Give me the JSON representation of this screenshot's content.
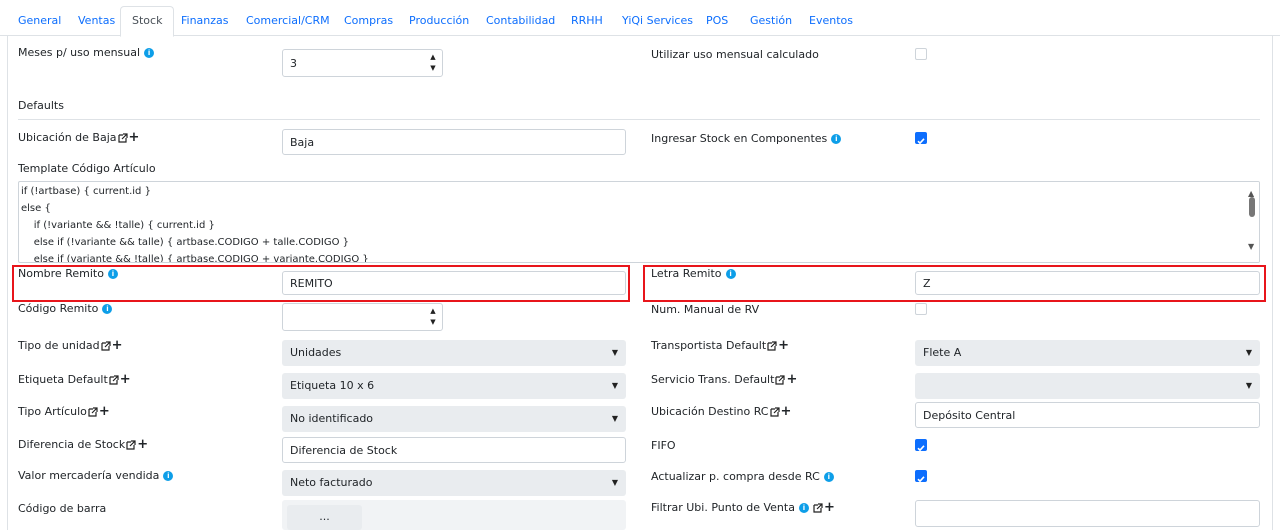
{
  "tabs": [
    "General",
    "Ventas",
    "Stock",
    "Finanzas",
    "Comercial/CRM",
    "Compras",
    "Producción",
    "Contabilidad",
    "RRHH",
    "YiQi Services",
    "POS",
    "Gestión",
    "Eventos"
  ],
  "fields": {
    "meses_label": "Meses p/ uso mensual",
    "meses_value": "3",
    "utilizar_label": "Utilizar uso mensual calculado",
    "defaults_label": "Defaults",
    "ubicacion_baja_label": "Ubicación de Baja",
    "ubicacion_baja_value": "Baja",
    "ingresar_stock_label": "Ingresar Stock en Componentes",
    "template_label": "Template Código Artículo",
    "template_lines": [
      "if (!artbase) { current.id }",
      "else {",
      "    if (!variante && !talle) { current.id }",
      "    else if (!variante && talle) { artbase.CODIGO + talle.CODIGO }",
      "    else if (variante && !talle) { artbase.CODIGO + variante.CODIGO }"
    ],
    "nombre_remito_label": "Nombre Remito",
    "nombre_remito_value": "REMITO",
    "letra_remito_label": "Letra Remito",
    "letra_remito_value": "Z",
    "codigo_remito_label": "Código Remito",
    "num_manual_label": "Num. Manual de RV",
    "tipo_unidad_label": "Tipo de unidad",
    "tipo_unidad_value": "Unidades",
    "transportista_label": "Transportista Default",
    "transportista_value": "Flete A",
    "etiqueta_label": "Etiqueta Default",
    "etiqueta_value": "Etiqueta 10 x 6",
    "servicio_label": "Servicio Trans. Default",
    "servicio_value": "",
    "tipo_articulo_label": "Tipo Artículo",
    "tipo_articulo_value": "No identificado",
    "ubicacion_destino_label": "Ubicación Destino RC",
    "ubicacion_destino_value": "Depósito Central",
    "diferencia_label": "Diferencia de Stock",
    "diferencia_value": "Diferencia de Stock",
    "fifo_label": "FIFO",
    "valor_label": "Valor mercadería vendida",
    "valor_value": "Neto facturado",
    "actualizar_label": "Actualizar p. compra desde RC",
    "codigo_barra_label": "Código de barra",
    "codigo_barra_btn": "...",
    "filtrar_label": "Filtrar Ubi. Punto de Venta"
  },
  "colors": {
    "accent": "#0d6efd",
    "highlight": "#e8151b",
    "info": "#0d9ee8"
  },
  "icons": {
    "info": "info-icon",
    "external": "external-link-icon",
    "add": "plus-icon"
  }
}
